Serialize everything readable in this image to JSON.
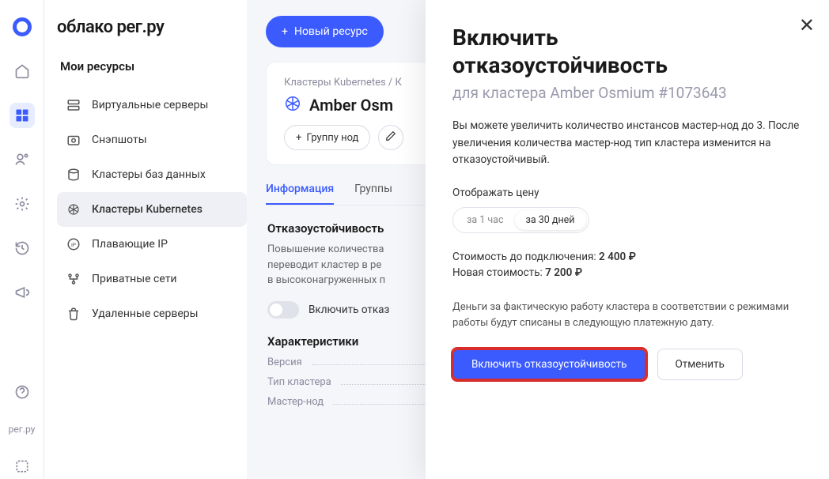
{
  "brand": {
    "title": "облако рег.ру"
  },
  "rail": {
    "footer_text": "рег.ру"
  },
  "sidebar": {
    "section": "Мои ресурсы",
    "items": [
      {
        "label": "Виртуальные серверы"
      },
      {
        "label": "Снэпшоты"
      },
      {
        "label": "Кластеры баз данных"
      },
      {
        "label": "Кластеры Kubernetes"
      },
      {
        "label": "Плавающие IP"
      },
      {
        "label": "Приватные сети"
      },
      {
        "label": "Удаленные серверы"
      }
    ]
  },
  "header": {
    "new_label": "Новый ресурс"
  },
  "crumbs": "Кластеры Kubernetes / К",
  "cluster": {
    "name": "Amber Osm"
  },
  "actions": {
    "add_group": "Группу нод"
  },
  "tabs": {
    "info": "Информация",
    "groups": "Группы"
  },
  "fault": {
    "title": "Отказоустойчивость",
    "desc": "Повышение количества\nпереводит кластер в ре\nв высоконагруженных п",
    "toggle_label": "Включить отказ"
  },
  "specs": {
    "title": "Характеристики",
    "rows": [
      "Версия",
      "Тип кластера",
      "Мастер-нод"
    ]
  },
  "modal": {
    "title_l1": "Включить",
    "title_l2": "отказоустойчивость",
    "subtitle": "для кластера Amber Osmium #1073643",
    "body": "Вы можете увеличить количество инстансов мастер-нод до 3. После увеличения количества мастер-нод тип кластера изменится на отказоустойчивый.",
    "price_label": "Отображать цену",
    "seg_hour": "за 1 час",
    "seg_month": "за 30 дней",
    "cost_before_label": "Стоимость до подключения: ",
    "cost_before_value": "2 400 ₽",
    "cost_after_label": "Новая стоимость: ",
    "cost_after_value": "7 200 ₽",
    "note": "Деньги за фактическую работу кластера в соответствии с режимами работы будут списаны в следующую платежную дату.",
    "confirm": "Включить отказоустойчивость",
    "cancel": "Отменить"
  }
}
